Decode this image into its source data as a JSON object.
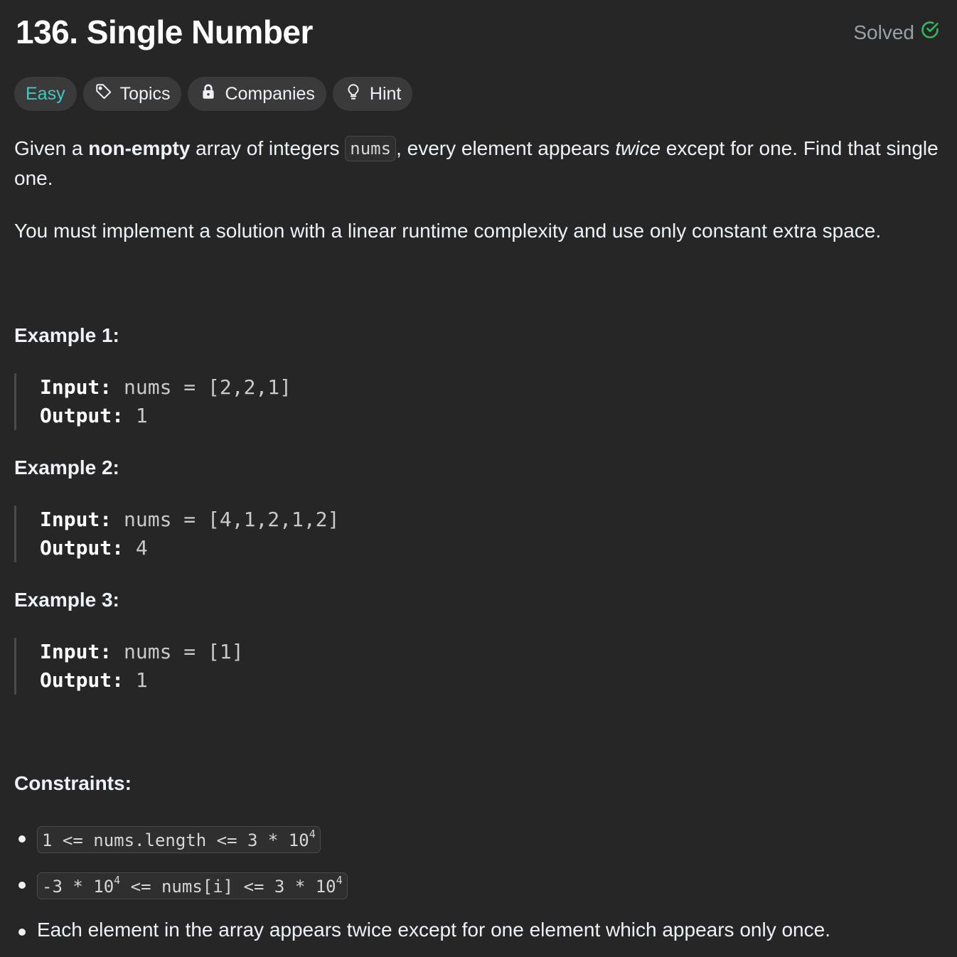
{
  "problem": {
    "title": "136. Single Number",
    "status": "Solved"
  },
  "tags": {
    "difficulty": "Easy",
    "topics": "Topics",
    "companies": "Companies",
    "hint": "Hint"
  },
  "description": {
    "p1_a": "Given a ",
    "p1_bold": "non-empty",
    "p1_b": " array of integers ",
    "p1_code": "nums",
    "p1_c": ", every element appears ",
    "p1_italic": "twice",
    "p1_d": " except for one. Find that single one.",
    "p2": "You must implement a solution with a linear runtime complexity and use only constant extra space."
  },
  "examples": [
    {
      "title": "Example 1:",
      "input_label": "Input:",
      "input": "nums = [2,2,1]",
      "output_label": "Output:",
      "output": "1"
    },
    {
      "title": "Example 2:",
      "input_label": "Input:",
      "input": "nums = [4,1,2,1,2]",
      "output_label": "Output:",
      "output": "4"
    },
    {
      "title": "Example 3:",
      "input_label": "Input:",
      "input": "nums = [1]",
      "output_label": "Output:",
      "output": "1"
    }
  ],
  "constraints": {
    "title": "Constraints:",
    "c1_a": "1 <= nums.length <= 3 * 10",
    "c1_sup": "4",
    "c2_a": "-3 * 10",
    "c2_sup1": "4",
    "c2_b": " <= nums[i] <= 3 * 10",
    "c2_sup2": "4",
    "c3": "Each element in the array appears twice except for one element which appears only once."
  },
  "colors": {
    "background": "#262626",
    "easy": "#46c6c2",
    "solved_check": "#2cbb5d",
    "tag_bg": "#3a3a3a"
  },
  "icons": {
    "solved": "check-circle-icon",
    "topics": "tag-icon",
    "companies": "lock-icon",
    "hint": "lightbulb-icon"
  }
}
